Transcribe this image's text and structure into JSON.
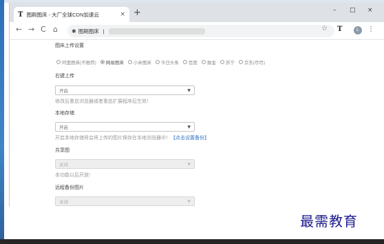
{
  "browser": {
    "tab_title": "图刷图床 - 大厂全球CDN加速云",
    "tab_icon": "T",
    "tab_close": "×",
    "new_tab": "+",
    "window_controls": {
      "minimize": "–",
      "maximize": "□",
      "close": "×"
    },
    "nav": {
      "back": "←",
      "forward": "→",
      "reload": "C",
      "home": "⌂"
    },
    "omnibox_label": "图刷图床",
    "omnibox_separator": "|",
    "star": "☆",
    "extension_letter": "T",
    "profile_initial": "L",
    "menu": "⋮"
  },
  "settings": {
    "upload_settings": {
      "title": "图床上传设置",
      "options": [
        "阿里图床(不推荐)",
        "网易图床",
        "小米图床",
        "今日头条",
        "百度",
        "掘金",
        "苏宁",
        "京东(尽尽)"
      ],
      "selected_index": 1
    },
    "context_upload": {
      "title": "右键上传",
      "value": "开启",
      "hint": "修改后重启浏览器或者重启扩展程序后生效！"
    },
    "local_storage": {
      "title": "本地存储",
      "value": "开启",
      "hint": "开启本地存储将会将上传的图片保存在本地浏览器中！",
      "link": "【点击设置备份】"
    },
    "shared_image": {
      "title": "共享图",
      "value": "关闭",
      "hint": "本功能以后开放!"
    },
    "backup_image": {
      "title": "远程备份图片",
      "value": "关闭"
    }
  },
  "watermark": "最需教育",
  "colors": {
    "accent": "#2f74c6",
    "watermark": "#1c1c8c",
    "titlebar": "#dee1e6"
  }
}
